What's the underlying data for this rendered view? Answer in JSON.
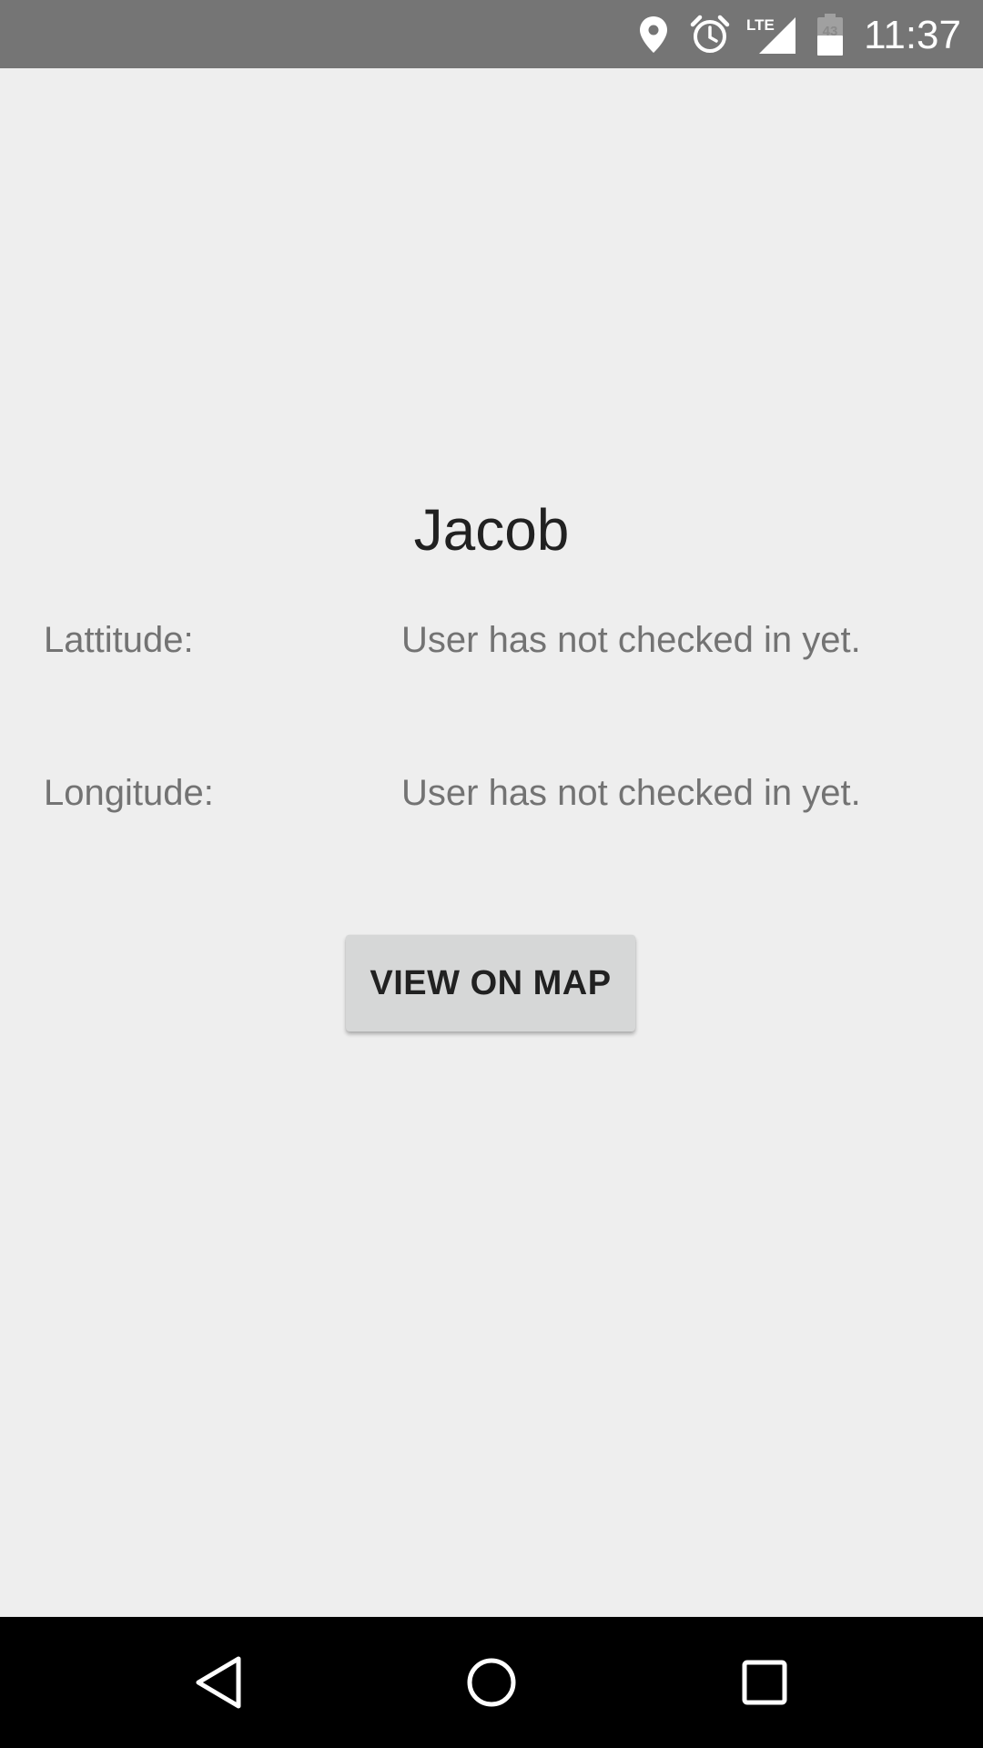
{
  "status_bar": {
    "time": "11:37",
    "battery_level": "43",
    "network_type": "LTE",
    "icons": [
      "location-icon",
      "alarm-icon",
      "signal-icon",
      "battery-icon"
    ],
    "background_color": "#757575"
  },
  "contact": {
    "name": "Jacob"
  },
  "fields": {
    "latitude_label": "Lattitude:",
    "latitude_value": "User has not checked in yet.",
    "longitude_label": "Longitude:",
    "longitude_value": "User has not checked in yet."
  },
  "actions": {
    "view_on_map_label": "VIEW ON MAP"
  },
  "nav_bar": {
    "icons": [
      "back-icon",
      "home-icon",
      "recents-icon"
    ]
  }
}
